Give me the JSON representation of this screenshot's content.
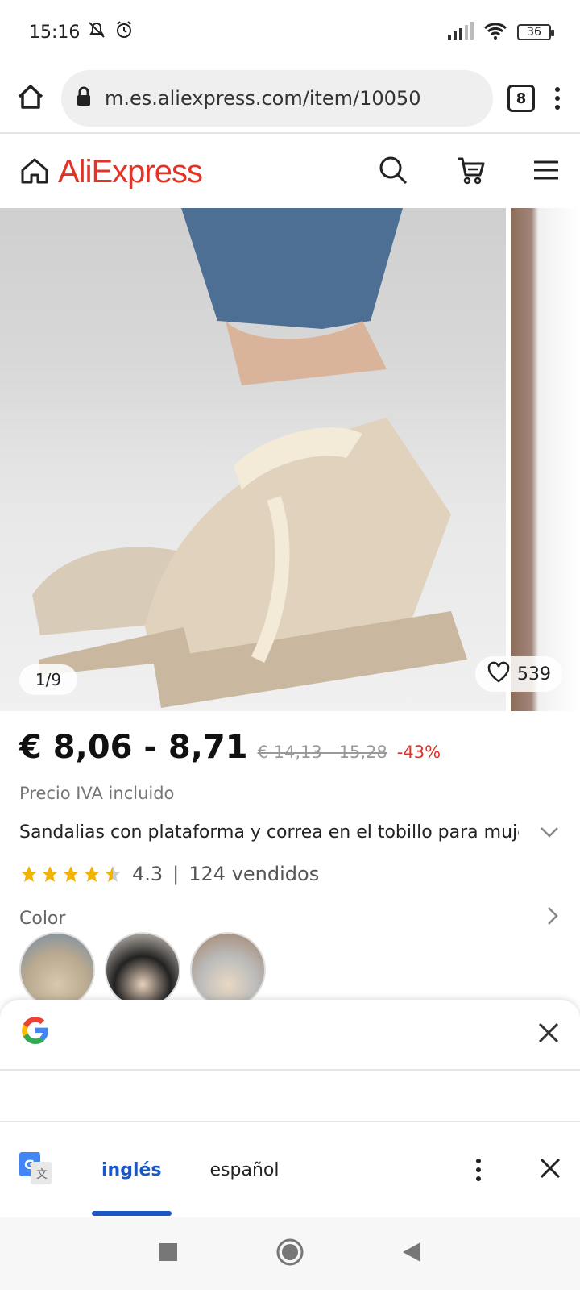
{
  "status": {
    "time": "15:16",
    "battery": "36"
  },
  "browser": {
    "url": "m.es.aliexpress.com/item/10050",
    "tab_count": "8"
  },
  "header": {
    "brand": "AliExpress"
  },
  "gallery": {
    "counter": "1/9",
    "wishlist_count": "539"
  },
  "product": {
    "price": "€ 8,06 - 8,71",
    "old_price": "€ 14,13 - 15,28",
    "discount": "-43%",
    "vat_note": "Precio IVA incluido",
    "title": "Sandalias con plataforma y correa en el tobillo para mujer, ...",
    "rating": "4.3",
    "sold": "124 vendidos",
    "color_label": "Color"
  },
  "translate": {
    "lang_from": "inglés",
    "lang_to": "español"
  },
  "colors": {
    "brand": "#e43225",
    "accent": "#1a56c4",
    "star": "#f5b301"
  }
}
